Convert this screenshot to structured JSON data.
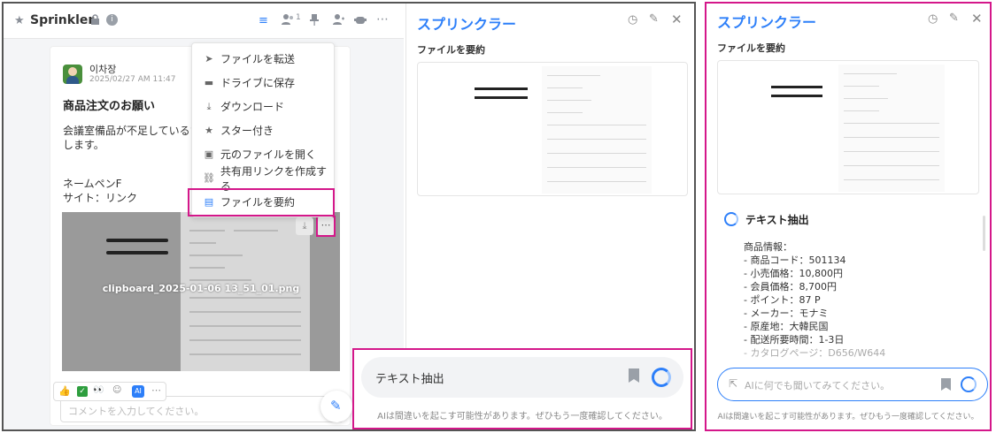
{
  "chat": {
    "title": "Sprinkler",
    "member_count": "1",
    "post": {
      "author": "이차장",
      "time": "2025/02/27 AM 11:47",
      "subject": "商品注文のお願い",
      "body_line1": "会議室備品が不足しているため",
      "body_line2": "します。",
      "line3": "ネームペンF",
      "line4": "サイト：リンク",
      "image_filename": "clipboard_2025-01-06 13_51_01.png"
    },
    "comment_placeholder": "コメントを入力してください。",
    "reactions": [
      "👍",
      "✅",
      "👀",
      "😂",
      "AI",
      "⋯"
    ]
  },
  "context_menu": {
    "items": [
      {
        "icon": "send-icon",
        "label": "ファイルを転送"
      },
      {
        "icon": "drive-icon",
        "label": "ドライブに保存"
      },
      {
        "icon": "download-icon",
        "label": "ダウンロード"
      },
      {
        "icon": "star-icon",
        "label": "スター付き"
      },
      {
        "icon": "open-file-icon",
        "label": "元のファイルを開く"
      },
      {
        "icon": "link-icon",
        "label": "共有用リンクを作成する"
      },
      {
        "icon": "summary-icon",
        "label": "ファイルを要約"
      }
    ]
  },
  "panel": {
    "title": "スプリンクラー",
    "section": "ファイルを要約",
    "input_label": "テキスト抽出",
    "disclaimer": "AIは間違いを起こす可能性があります。ぜひもう一度確認してください。"
  },
  "panel2": {
    "title": "スプリンクラー",
    "section": "ファイルを要約",
    "extract_title": "テキスト抽出",
    "info": [
      "商品情報：",
      "- 商品コード：501134",
      "- 小売価格：10,800円",
      "- 会員価格：8,700円",
      "- ポイント：87 P",
      "- メーカー：モナミ",
      "- 原産地：大韓民国",
      "- 配送所要時間：1-3日",
      "- カタログページ：D656/W644"
    ],
    "input_placeholder": "AIに何でも聞いてみてください。",
    "disclaimer": "AIは間違いを起こす可能性があります。ぜひもう一度確認してください。"
  },
  "colors": {
    "accent": "#2d7ff9",
    "highlight": "#d4178a"
  }
}
